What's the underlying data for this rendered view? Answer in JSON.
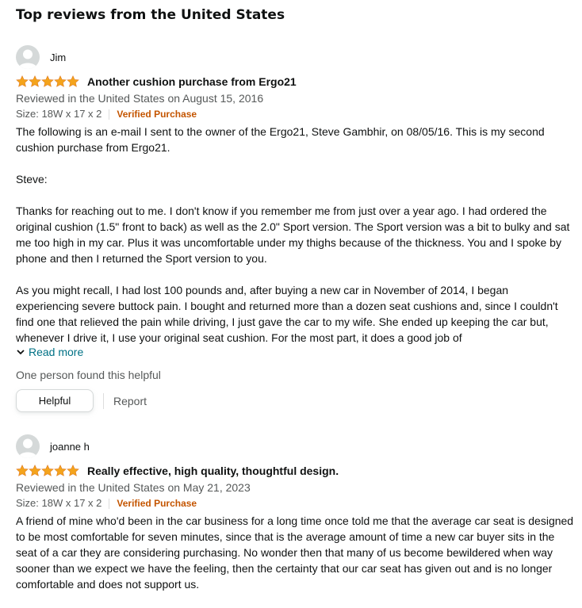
{
  "section_title": "Top reviews from the United States",
  "reviews": [
    {
      "username": "Jim",
      "rating": 5,
      "title": "Another cushion purchase from Ergo21",
      "date": "Reviewed in the United States on August 15, 2016",
      "size": "Size: 18W x 17 x 2",
      "verified": "Verified Purchase",
      "paragraphs": [
        "The following is an e-mail I sent to the owner of the Ergo21, Steve Gambhir, on 08/05/16. This is my second cushion purchase from Ergo21.",
        "Steve:",
        "Thanks for reaching out to me. I don't know if you remember me from just over a year ago. I had ordered the original cushion (1.5\" front to back) as well as the 2.0\" Sport version. The Sport version was a bit to bulky and sat me too high in my car. Plus it was uncomfortable under my thighs because of the thickness. You and I spoke by phone and then I returned the Sport version to you.",
        "As you might recall, I had lost 100 pounds and, after buying a new car in November of 2014, I began experiencing severe buttock pain. I bought and returned more than a dozen seat cushions and, since I couldn't find one that relieved the pain while driving, I just gave the car to my wife. She ended up keeping the car but, whenever I drive it, I use your original seat cushion. For the most part, it does a good job of"
      ],
      "read_more": "Read more",
      "helpful_count": "One person found this helpful",
      "helpful_button": "Helpful",
      "report": "Report"
    },
    {
      "username": "joanne h",
      "rating": 5,
      "title": "Really effective, high quality, thoughtful design.",
      "date": "Reviewed in the United States on May 21, 2023",
      "size": "Size: 18W x 17 x 2",
      "verified": "Verified Purchase",
      "paragraphs": [
        "A friend of mine who'd been in the car business for a long time once told me that the average car seat is designed to be most comfortable for seven minutes, since that is the average amount of time a new car buyer sits in the seat of a car they are considering purchasing. No wonder then that many of us become bewildered when way sooner than we expect we have the feeling, then the certainty that our car seat has given out and is no longer comfortable and does not support us."
      ]
    }
  ],
  "colors": {
    "star": "#f4a41c",
    "verified": "#c45500",
    "link": "#007185",
    "muted": "#565959"
  },
  "icons": {
    "avatar": "default-user-icon",
    "star": "star-icon",
    "read_more": "chevron-down-icon"
  }
}
